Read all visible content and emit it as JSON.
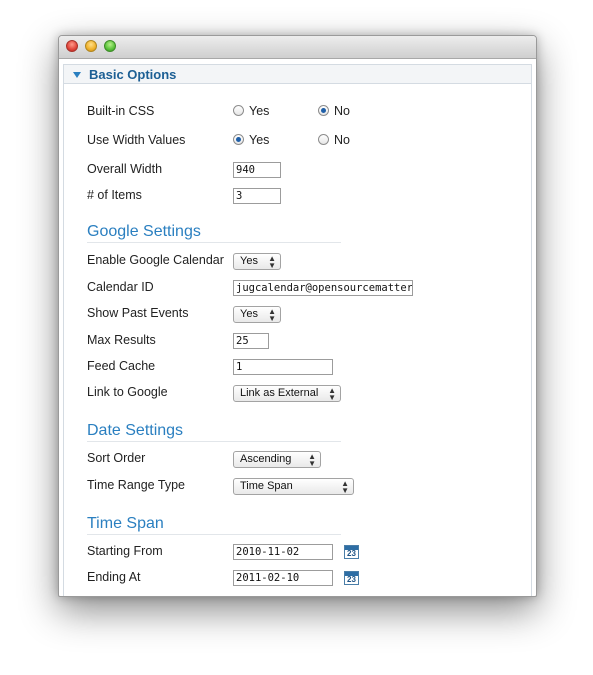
{
  "panel": {
    "title": "Basic Options"
  },
  "fields": {
    "builtin_css": {
      "label": "Built-in CSS",
      "yes": "Yes",
      "no": "No",
      "selected": "No"
    },
    "use_width": {
      "label": "Use Width Values",
      "yes": "Yes",
      "no": "No",
      "selected": "Yes"
    },
    "overall_width": {
      "label": "Overall Width",
      "value": "940"
    },
    "num_items": {
      "label": "# of Items",
      "value": "3"
    }
  },
  "google": {
    "heading": "Google Settings",
    "enable": {
      "label": "Enable Google Calendar",
      "value": "Yes"
    },
    "calendar_id": {
      "label": "Calendar ID",
      "value": "jugcalendar@opensourcematters.org"
    },
    "past_events": {
      "label": "Show Past Events",
      "value": "Yes"
    },
    "max_results": {
      "label": "Max Results",
      "value": "25"
    },
    "feed_cache": {
      "label": "Feed Cache",
      "value": "1"
    },
    "link": {
      "label": "Link to Google",
      "value": "Link as External"
    }
  },
  "date": {
    "heading": "Date Settings",
    "sort_order": {
      "label": "Sort Order",
      "value": "Ascending"
    },
    "time_range": {
      "label": "Time Range Type",
      "value": "Time Span"
    }
  },
  "timespan": {
    "heading": "Time Span",
    "start": {
      "label": "Starting From",
      "value": "2010-11-02"
    },
    "end": {
      "label": "Ending At",
      "value": "2011-02-10"
    },
    "calendar_day": "23"
  },
  "colors": {
    "accent": "#2a7fc0",
    "header_text": "#1c5f94"
  }
}
